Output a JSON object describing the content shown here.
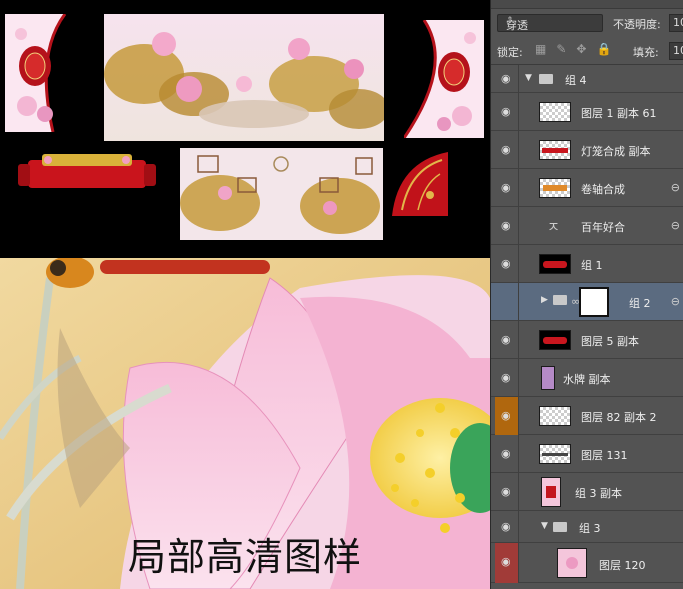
{
  "detail_caption": "局部高清图样",
  "layers_panel": {
    "blend_mode": "穿透",
    "opacity_label": "不透明度:",
    "opacity_value": "10",
    "lock_label": "锁定:",
    "fill_label": "填充:",
    "fill_value": "10",
    "layers": [
      {
        "name": "组 4",
        "kind": "group-open"
      },
      {
        "name": "图层 1 副本 61",
        "kind": "layer"
      },
      {
        "name": "灯笼合成 副本",
        "kind": "layer"
      },
      {
        "name": "卷轴合成",
        "kind": "layer",
        "linked": true
      },
      {
        "name": "百年好合",
        "kind": "text",
        "linked": true
      },
      {
        "name": "组 1",
        "kind": "layer"
      },
      {
        "name": "组 2",
        "kind": "group-closed",
        "selected": true,
        "linked": true
      },
      {
        "name": "图层 5 副本",
        "kind": "layer"
      },
      {
        "name": "水牌 副本",
        "kind": "layer"
      },
      {
        "name": "图层 82 副本 2",
        "kind": "layer",
        "eye_color": "orange"
      },
      {
        "name": "图层 131",
        "kind": "layer"
      },
      {
        "name": "组 3 副本",
        "kind": "layer"
      },
      {
        "name": "组 3",
        "kind": "group-open"
      },
      {
        "name": "图层 120",
        "kind": "layer",
        "eye_color": "red"
      }
    ]
  },
  "colors": {
    "panel_bg": "#535353",
    "selected_row": "#5b6b80",
    "eye_orange": "#b0670e",
    "eye_red": "#a13b38",
    "canvas_bg": "#000000"
  },
  "icons": {
    "visibility": "eye-icon",
    "link": "link-icon",
    "folder": "folder-icon",
    "text_layer": "text-layer-icon",
    "expand": "caret-icon"
  }
}
